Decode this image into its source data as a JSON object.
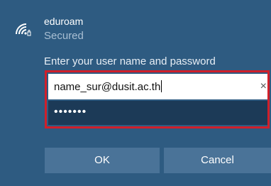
{
  "network": {
    "name": "eduroam",
    "status": "Secured",
    "icon": "wifi-secured-icon"
  },
  "credentials": {
    "prompt": "Enter your user name and password",
    "username_value": "name_sur@dusit.ac.th",
    "password_masked": "•••••••",
    "clear_icon": "×"
  },
  "buttons": {
    "ok_label": "OK",
    "cancel_label": "Cancel"
  },
  "colors": {
    "background": "#2e5b81",
    "highlight": "#d01f2a",
    "button": "#4a7398",
    "password_field": "#1c3a57"
  }
}
